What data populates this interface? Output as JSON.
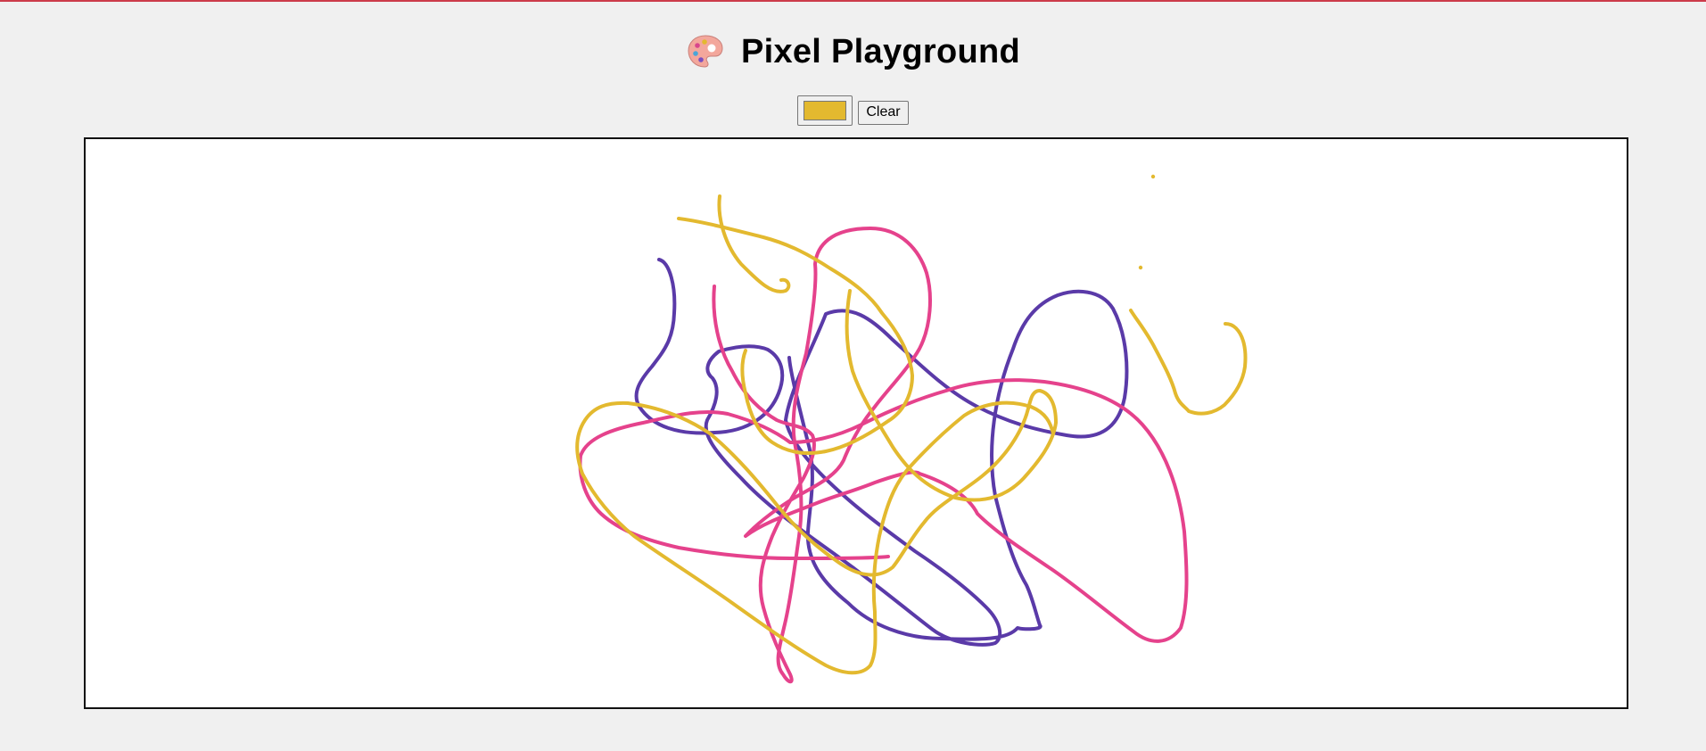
{
  "app": {
    "title": "Pixel Playground",
    "title_icon": "artist-palette-icon"
  },
  "toolbar": {
    "color_picker_value": "#e3b92f",
    "clear_label": "Clear"
  },
  "canvas": {
    "background": "#ffffff",
    "stroke_colors": {
      "purple": "#5a3aa8",
      "pink": "#e5428c",
      "yellow": "#e3b92f"
    }
  }
}
